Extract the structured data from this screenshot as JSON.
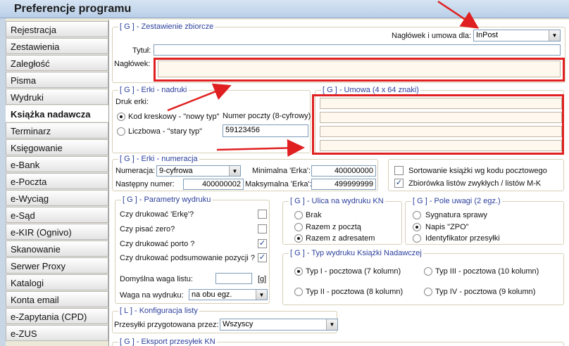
{
  "title": "Preferencje programu",
  "sidebar": {
    "items": [
      {
        "label": "Rejestracja",
        "active": false
      },
      {
        "label": "Zestawienia",
        "active": false
      },
      {
        "label": "Zaległość",
        "active": false
      },
      {
        "label": "Pisma",
        "active": false
      },
      {
        "label": "Wydruki",
        "active": false
      },
      {
        "label": "Książka nadawcza",
        "active": true
      },
      {
        "label": "Terminarz",
        "active": false
      },
      {
        "label": "Księgowanie",
        "active": false
      },
      {
        "label": "e-Bank",
        "active": false
      },
      {
        "label": "e-Poczta",
        "active": false
      },
      {
        "label": "e-Wyciąg",
        "active": false
      },
      {
        "label": "e-Sąd",
        "active": false
      },
      {
        "label": "e-KIR (Ognivo)",
        "active": false
      },
      {
        "label": "Skanowanie",
        "active": false
      },
      {
        "label": "Serwer Proxy",
        "active": false
      },
      {
        "label": "Katalogi",
        "active": false
      },
      {
        "label": "Konta email",
        "active": false
      },
      {
        "label": "e-Zapytania (CPD)",
        "active": false
      },
      {
        "label": "e-ZUS",
        "active": false
      }
    ]
  },
  "zestawienie": {
    "title": "[ G ] - Zestawienie zbiorcze",
    "naglowek_umowa_label": "Nagłówek i umowa dla:",
    "naglowek_umowa_value": "InPost",
    "tytul_label": "Tytuł:",
    "tytul_value": "",
    "naglowek_label": "Nagłówek:",
    "naglowek_value": ""
  },
  "erki_nadruki": {
    "title": "[ G ] - Erki - nadruki",
    "druk_label": "Druk erki:",
    "opt_kod": "Kod kreskowy - \"nowy typ\"",
    "opt_liczbowa": "Liczbowa - \"stary typ\"",
    "numer_poczty_label": "Numer poczty (8-cyfrowy)",
    "numer_poczty_value": "59123456"
  },
  "umowa": {
    "title": "[ G ] - Umowa  (4 x 64 znaki)",
    "lines": [
      "",
      "",
      "",
      ""
    ]
  },
  "erki_numeracja": {
    "title": "[ G ] - Erki - numeracja",
    "numeracja_label": "Numeracja:",
    "numeracja_value": "9-cyfrowa",
    "nastepny_label": "Następny numer:",
    "nastepny_value": "400000002",
    "min_label": "Minimalna 'Erka':",
    "min_value": "400000000",
    "max_label": "Maksymalna 'Erka':",
    "max_value": "499999999"
  },
  "sortowanie": {
    "sort_label": "Sortowanie książki wg kodu pocztowego",
    "sort_checked": false,
    "zbiorowka_label": "Zbiorówka listów zwykłych / listów M-K",
    "zbiorowka_checked": true
  },
  "parametry": {
    "title": "[ G ] - Parametry wydruku",
    "drukowac_erke": "Czy drukować 'Erkę'?",
    "drukowac_erke_checked": false,
    "pisac_zero": "Czy pisać zero?",
    "pisac_zero_checked": false,
    "drukowac_porto": "Czy drukować porto ?",
    "drukowac_porto_checked": true,
    "podsumowanie": "Czy drukować podsumowanie pozycji ?",
    "podsumowanie_checked": true,
    "waga_label": "Domyślna waga listu:",
    "waga_value": "",
    "waga_unit": "[g]",
    "waga_wydruk_label": "Waga na wydruku:",
    "waga_wydruk_value": "na obu egz."
  },
  "ulica": {
    "title": "[ G ] - Ulica na wydruku KN",
    "opt_brak": "Brak",
    "opt_poczta": "Razem z pocztą",
    "opt_adresatem": "Razem z adresatem"
  },
  "pole_uwagi": {
    "title": "[ G ] - Pole uwagi (2 egz.)",
    "opt_sygnatura": "Sygnatura sprawy",
    "opt_napis": "Napis \"ZPO\"",
    "opt_identyfikator": "Identyfikator przesyłki"
  },
  "typ_wydruku": {
    "title": "[ G ] - Typ wydruku Książki Nadawczej",
    "opt1": "Typ I  - pocztowa  (7 kolumn)",
    "opt2": "Typ II - pocztowa  (8 kolumn)",
    "opt3": "Typ III - pocztowa (10 kolumn)",
    "opt4": "Typ IV - pocztowa  (9 kolumn)"
  },
  "konfiguracja": {
    "title": "[ L ] - Konfiguracja listy",
    "przesylki_label": "Przesyłki przygotowana przez:",
    "przesylki_value": "Wszyscy"
  },
  "eksport": {
    "title": "[ G ] - Eksport przesyłek KN"
  },
  "colors": {
    "annotation_red": "#e02020",
    "group_title_blue": "#2b3f9c",
    "input_cream": "#fff8ee"
  }
}
